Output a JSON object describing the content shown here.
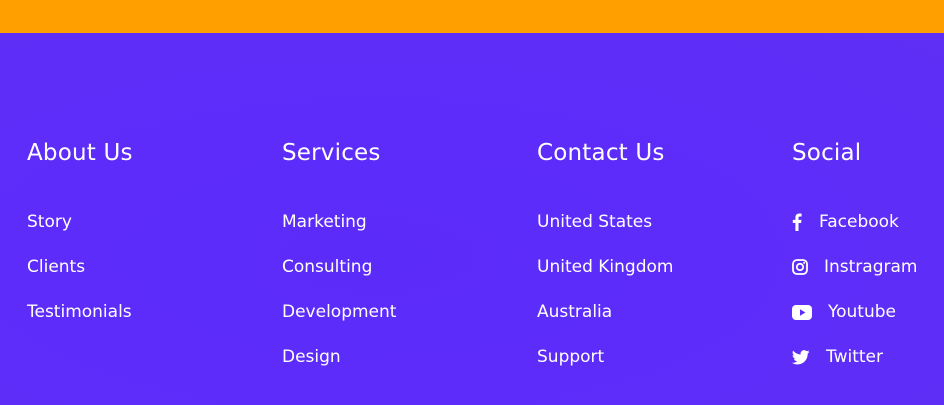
{
  "colors": {
    "top_bar": "#ffa000",
    "footer_bg": "#5b2bf9",
    "text": "#ffffff"
  },
  "about": {
    "title": "About Us",
    "links": [
      "Story",
      "Clients",
      "Testimonials"
    ]
  },
  "services": {
    "title": "Services",
    "links": [
      "Marketing",
      "Consulting",
      "Development",
      "Design"
    ]
  },
  "contact": {
    "title": "Contact Us",
    "links": [
      "United States",
      "United Kingdom",
      "Australia",
      "Support"
    ]
  },
  "social": {
    "title": "Social",
    "links": [
      {
        "label": "Facebook",
        "icon": "facebook-icon"
      },
      {
        "label": "Instragram",
        "icon": "instagram-icon"
      },
      {
        "label": "Youtube",
        "icon": "youtube-icon"
      },
      {
        "label": "Twitter",
        "icon": "twitter-icon"
      }
    ]
  }
}
